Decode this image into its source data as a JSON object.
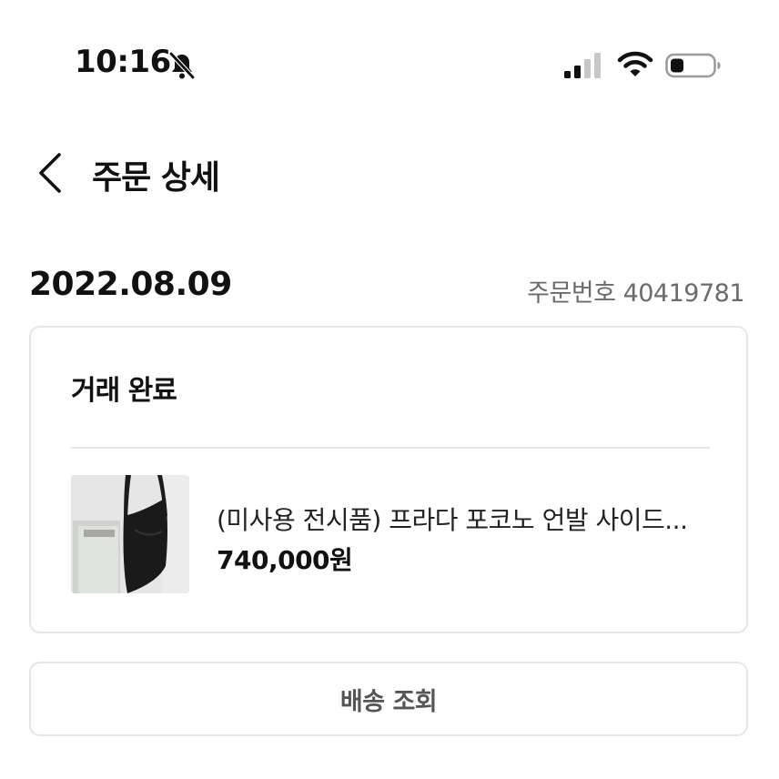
{
  "status_bar": {
    "time": "10:16",
    "icons": [
      "bell-slash-icon",
      "signal-icon",
      "wifi-icon",
      "battery-icon"
    ]
  },
  "header": {
    "back_icon": "chevron-left-icon",
    "title": "주문 상세"
  },
  "order": {
    "date": "2022.08.09",
    "number_label": "주문번호 40419781"
  },
  "card": {
    "status": "거래 완료",
    "product": {
      "name": "(미사용 전시품) 프라다 포코노 언발 사이드...",
      "price": "740,000원"
    }
  },
  "actions": {
    "shipping_label": "배송 조회"
  },
  "colors": {
    "text": "#111111",
    "muted": "#6b6b6b",
    "border": "#e6e6e6",
    "button_text": "#555555"
  }
}
